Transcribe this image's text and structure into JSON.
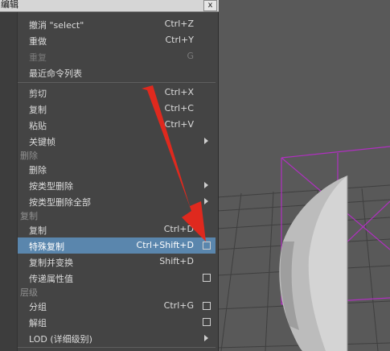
{
  "window": {
    "title": "编辑",
    "close_label": "x"
  },
  "items": {
    "undo": {
      "label": "撤消 \"select\"",
      "shortcut": "Ctrl+Z"
    },
    "redo": {
      "label": "重做",
      "shortcut": "Ctrl+Y"
    },
    "repeat": {
      "label": "重复",
      "shortcut": "G"
    },
    "recent": {
      "label": "最近命令列表"
    },
    "cut": {
      "label": "剪切",
      "shortcut": "Ctrl+X"
    },
    "copy": {
      "label": "复制",
      "shortcut": "Ctrl+C"
    },
    "paste": {
      "label": "粘贴",
      "shortcut": "Ctrl+V"
    },
    "keys": {
      "label": "关键帧"
    },
    "delete_section": {
      "label": "删除"
    },
    "delete": {
      "label": "删除"
    },
    "delete_by_type": {
      "label": "按类型删除"
    },
    "delete_all_by_type": {
      "label": "按类型删除全部"
    },
    "duplicate_section": {
      "label": "复制"
    },
    "duplicate": {
      "label": "复制",
      "shortcut": "Ctrl+D"
    },
    "duplicate_special": {
      "label": "特殊复制",
      "shortcut": "Ctrl+Shift+D"
    },
    "duplicate_transform": {
      "label": "复制并变换",
      "shortcut": "Shift+D"
    },
    "transfer_attr": {
      "label": "传递属性值"
    },
    "hierarchy_section": {
      "label": "层级"
    },
    "group": {
      "label": "分组",
      "shortcut": "Ctrl+G"
    },
    "ungroup": {
      "label": "解组"
    },
    "lod": {
      "label": "LOD (详细级别)"
    }
  },
  "colors": {
    "highlight": "#5a86ad",
    "menu_bg": "#444444",
    "annotation_arrow": "#e8281c",
    "wire_box": "#b030c0"
  }
}
